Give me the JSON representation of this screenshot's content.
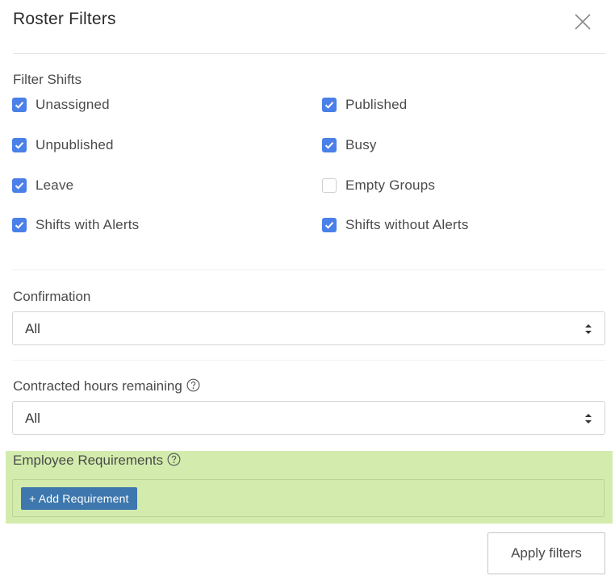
{
  "header": {
    "title": "Roster Filters",
    "close_icon": "close-icon"
  },
  "filter_shifts": {
    "label": "Filter Shifts",
    "options": [
      {
        "label": "Unassigned",
        "checked": true
      },
      {
        "label": "Published",
        "checked": true
      },
      {
        "label": "Unpublished",
        "checked": true
      },
      {
        "label": "Busy",
        "checked": true
      },
      {
        "label": "Leave",
        "checked": true
      },
      {
        "label": "Empty Groups",
        "checked": false
      },
      {
        "label": "Shifts with Alerts",
        "checked": true
      },
      {
        "label": "Shifts without Alerts",
        "checked": true
      }
    ]
  },
  "confirmation": {
    "label": "Confirmation",
    "selected": "All"
  },
  "contracted_hours": {
    "label": "Contracted hours remaining",
    "selected": "All",
    "help_icon": "help-icon"
  },
  "employee_requirements": {
    "label": "Employee Requirements",
    "add_button": "+ Add Requirement",
    "help_icon": "help-icon"
  },
  "footer": {
    "apply_label": "Apply filters"
  },
  "colors": {
    "accent": "#4a80e8",
    "highlight": "#d3ecad",
    "button": "#3d77ad"
  }
}
